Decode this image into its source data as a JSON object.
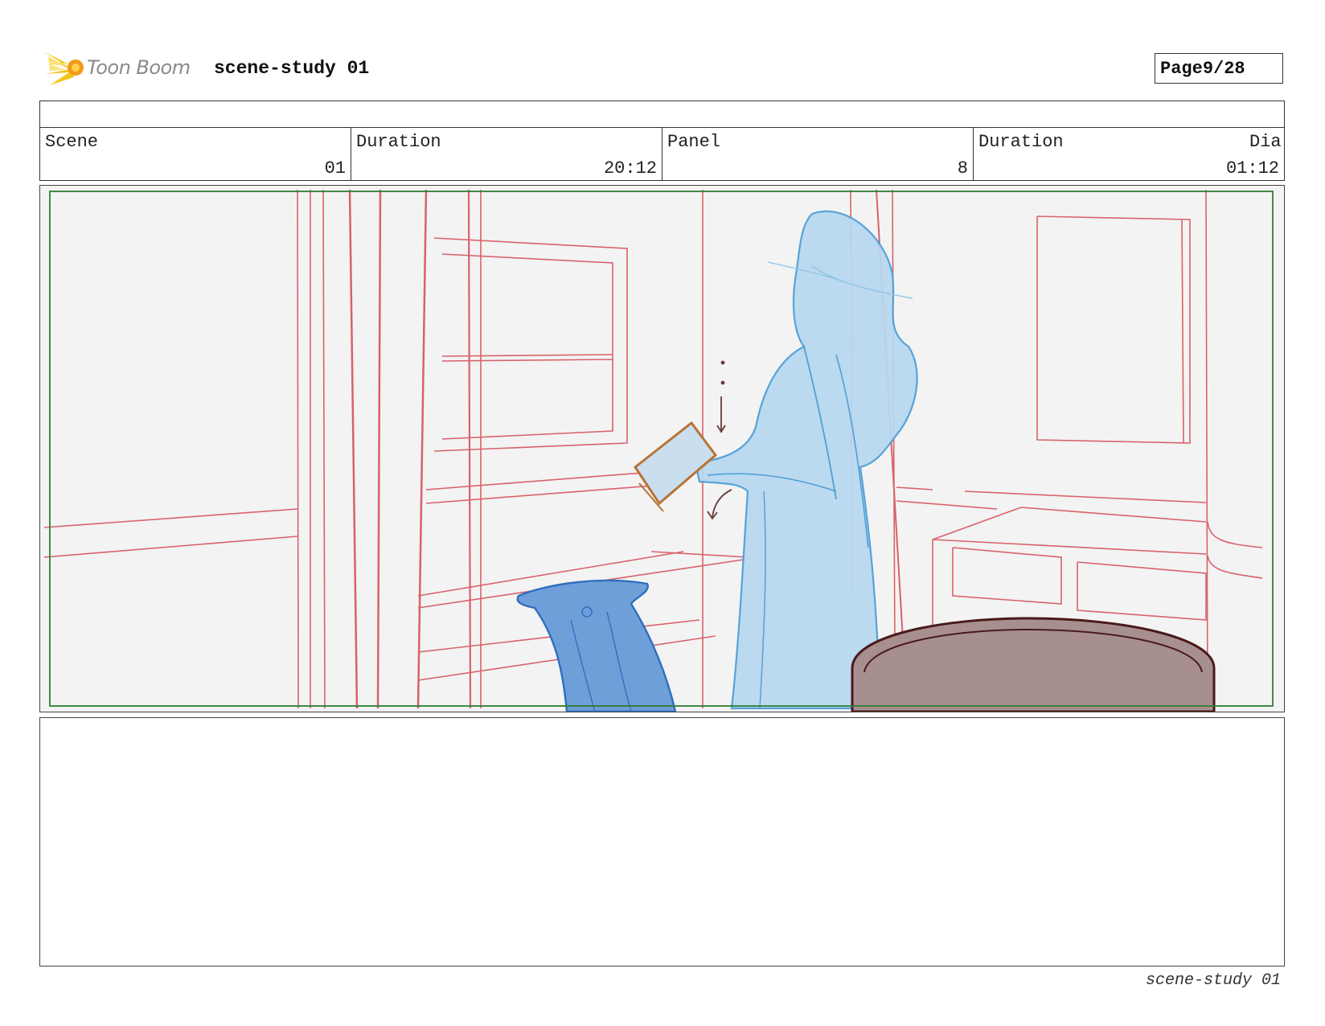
{
  "header": {
    "brand": "Toon Boom",
    "project_title": "scene-study 01",
    "page_label": "Page",
    "page_value": "9/28"
  },
  "info": {
    "scene_label": "Scene",
    "scene_value": "01",
    "scene_duration_label": "Duration",
    "scene_duration_value": "20:12",
    "panel_label": "Panel",
    "panel_value": "8",
    "panel_duration_label": "Duration",
    "panel_duration_value": "01:12",
    "dialog_label": "Dia"
  },
  "footer": {
    "project_title": "scene-study 01"
  },
  "colors": {
    "background_lines": "#d6525c",
    "character": "#8ec4e8",
    "character_lines": "#4f9fd6",
    "book": "#b87333",
    "cloth": "#6f9fd8",
    "table": "#a88f8f",
    "table_rim": "#4a1a1a",
    "safe_frame": "#2e7d32"
  }
}
